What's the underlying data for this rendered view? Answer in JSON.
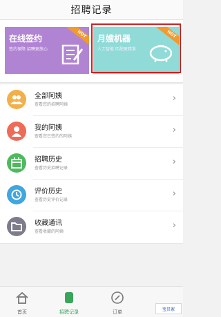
{
  "header": {
    "title": "招聘记录"
  },
  "cards": [
    {
      "title": "在线签约",
      "subtitle": "签约保障 招聘更放心",
      "hot": "HOT",
      "color": "#b184d3"
    },
    {
      "title": "月嫂机器",
      "subtitle": "人工智能 匹配更精准",
      "hot": "HOT",
      "color": "#90dbd8"
    }
  ],
  "list": [
    {
      "title": "全部阿姨",
      "subtitle": "查看您的招聘阿姨",
      "icon": "people-icon",
      "color": "#f2b04a"
    },
    {
      "title": "我的阿姨",
      "subtitle": "查看您已签约的阿姨",
      "icon": "person-icon",
      "color": "#ee6b57"
    },
    {
      "title": "招聘历史",
      "subtitle": "查看历史招聘记录",
      "icon": "calendar-icon",
      "color": "#4fb95f"
    },
    {
      "title": "评价历史",
      "subtitle": "查看历史评价记录",
      "icon": "clock-icon",
      "color": "#3fa7df"
    },
    {
      "title": "收藏通讯",
      "subtitle": "查看收藏的阿姨",
      "icon": "folder-icon",
      "color": "#7c7c8c"
    }
  ],
  "tabs": [
    {
      "label": "首页",
      "icon": "home-icon"
    },
    {
      "label": "招聘记录",
      "icon": "record-icon"
    },
    {
      "label": "订单",
      "icon": "compass-icon"
    }
  ],
  "watermark": "宝贝家"
}
